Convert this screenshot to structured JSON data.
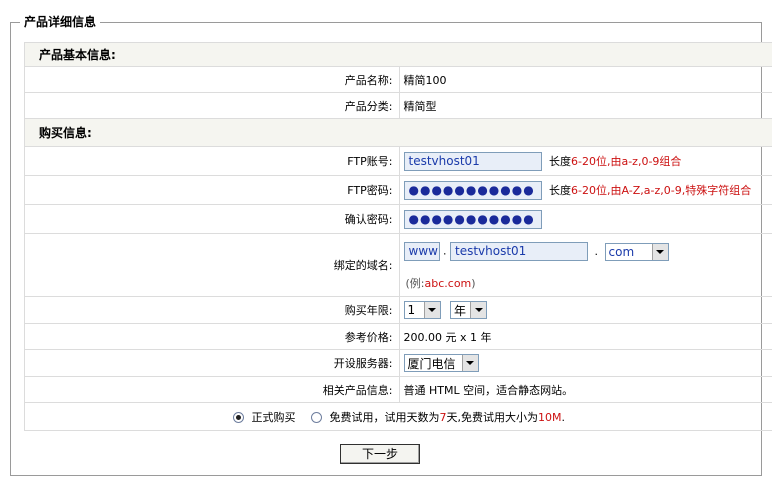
{
  "legend": "产品详细信息",
  "basic": {
    "header": "产品基本信息:",
    "name_label": "产品名称:",
    "name_value": "精简100",
    "category_label": "产品分类:",
    "category_value": "精简型"
  },
  "purchase": {
    "header": "购买信息:",
    "ftp_account_label": "FTP账号:",
    "ftp_account_value": "testvhost01",
    "ftp_account_hint_prefix": "长度",
    "ftp_account_hint": "6-20位,由a-z,0-9组合",
    "ftp_password_label": "FTP密码:",
    "ftp_password_value": "●●●●●●●●●●●",
    "ftp_password_hint_prefix": "长度",
    "ftp_password_hint": "6-20位,由A-Z,a-z,0-9,特殊字符组合",
    "confirm_password_label": "确认密码:",
    "confirm_password_value": "●●●●●●●●●●●",
    "domain_label": "绑定的域名:",
    "domain_prefix": "www",
    "domain_dot": ".",
    "domain_name": "testvhost01",
    "domain_suffix": "com",
    "domain_example_prefix": "(例:",
    "domain_example": "abc.com",
    "domain_example_suffix": ")",
    "years_label": "购买年限:",
    "years_value": "1",
    "years_unit": "年",
    "price_label": "参考价格:",
    "price_value": "200.00 元 x 1 年",
    "server_label": "开设服务器:",
    "server_value": "厦门电信",
    "related_label": "相关产品信息:",
    "related_value": "普通 HTML 空间，适合静态网站。"
  },
  "options": {
    "formal_label": "正式购买",
    "trial_label": "免费试用",
    "trial_desc_1": "，试用天数为",
    "trial_days": "7",
    "trial_desc_2": "天,免费试用大小为",
    "trial_size": "10M",
    "trial_desc_3": "."
  },
  "next_button": "下一步"
}
